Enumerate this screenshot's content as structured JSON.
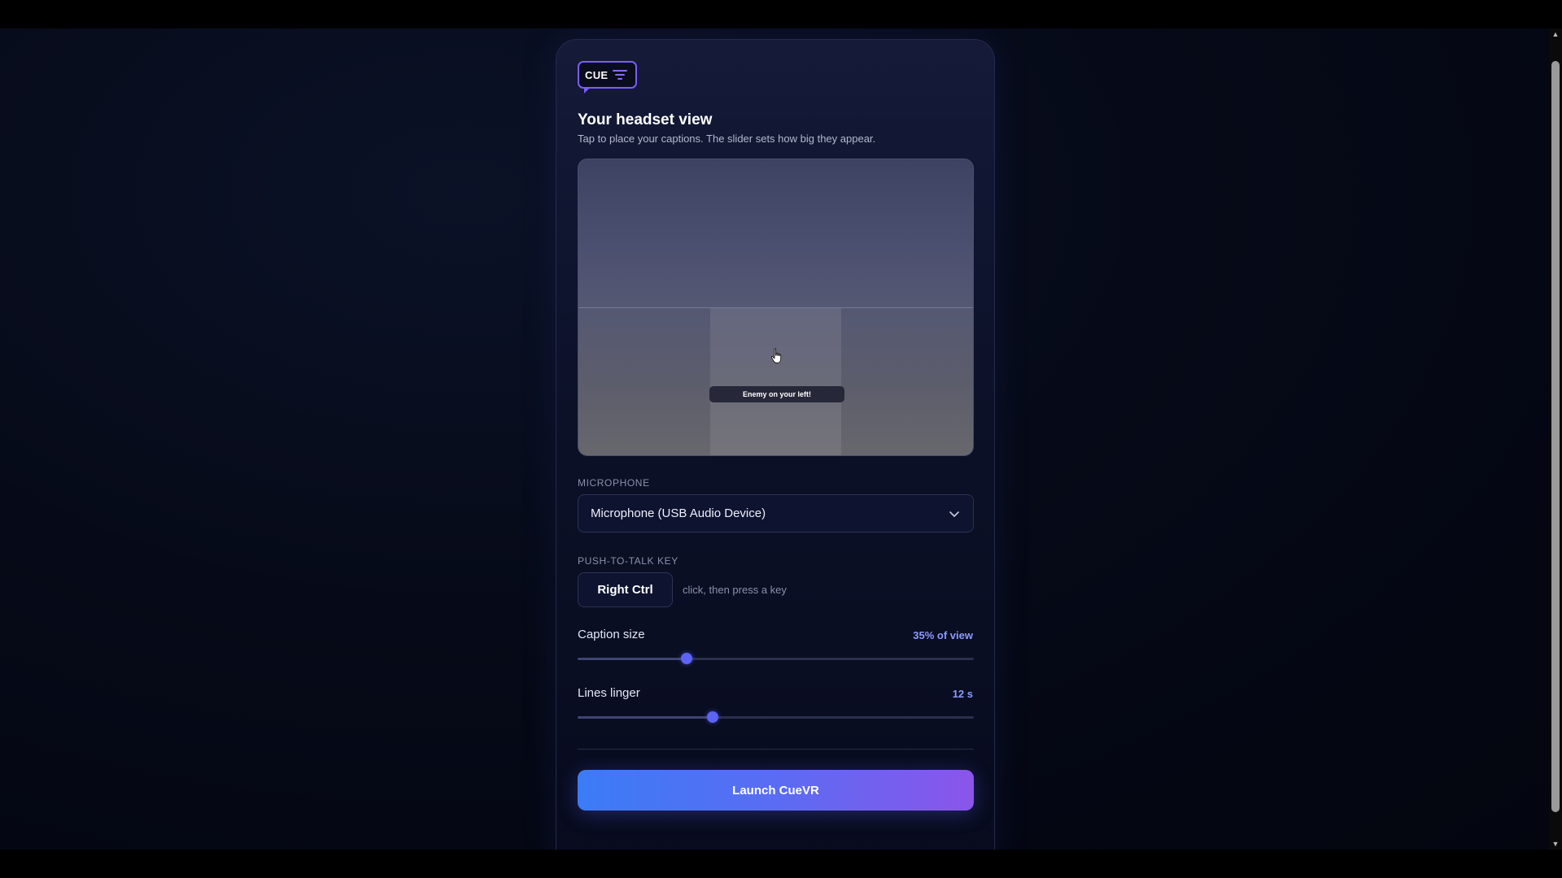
{
  "logo": {
    "text": "CUE",
    "icon": "menu-lines-icon"
  },
  "header": {
    "title": "Your headset view",
    "subtitle": "Tap to place your captions. The slider sets how big they appear."
  },
  "preview": {
    "caption_text": "Enemy on your left!",
    "cursor_icon": "hand-pointer-icon"
  },
  "microphone": {
    "label": "MICROPHONE",
    "selected": "Microphone (USB Audio Device)",
    "icon": "chevron-down-icon"
  },
  "push_to_talk": {
    "label": "PUSH-TO-TALK KEY",
    "key": "Right Ctrl",
    "hint": "click, then press a key"
  },
  "caption_size": {
    "label": "Caption size",
    "value_text": "35% of view",
    "level": 0.275
  },
  "lines_linger": {
    "label": "Lines linger",
    "value_text": "12 s",
    "level": 0.34
  },
  "launch": {
    "label": "Launch CueVR"
  },
  "colors": {
    "accent": "#5b64f5",
    "value_text": "#8c9bff",
    "button_start": "#3b7cf6",
    "button_end": "#8b55ea",
    "logo_border": "#7a5cff"
  }
}
